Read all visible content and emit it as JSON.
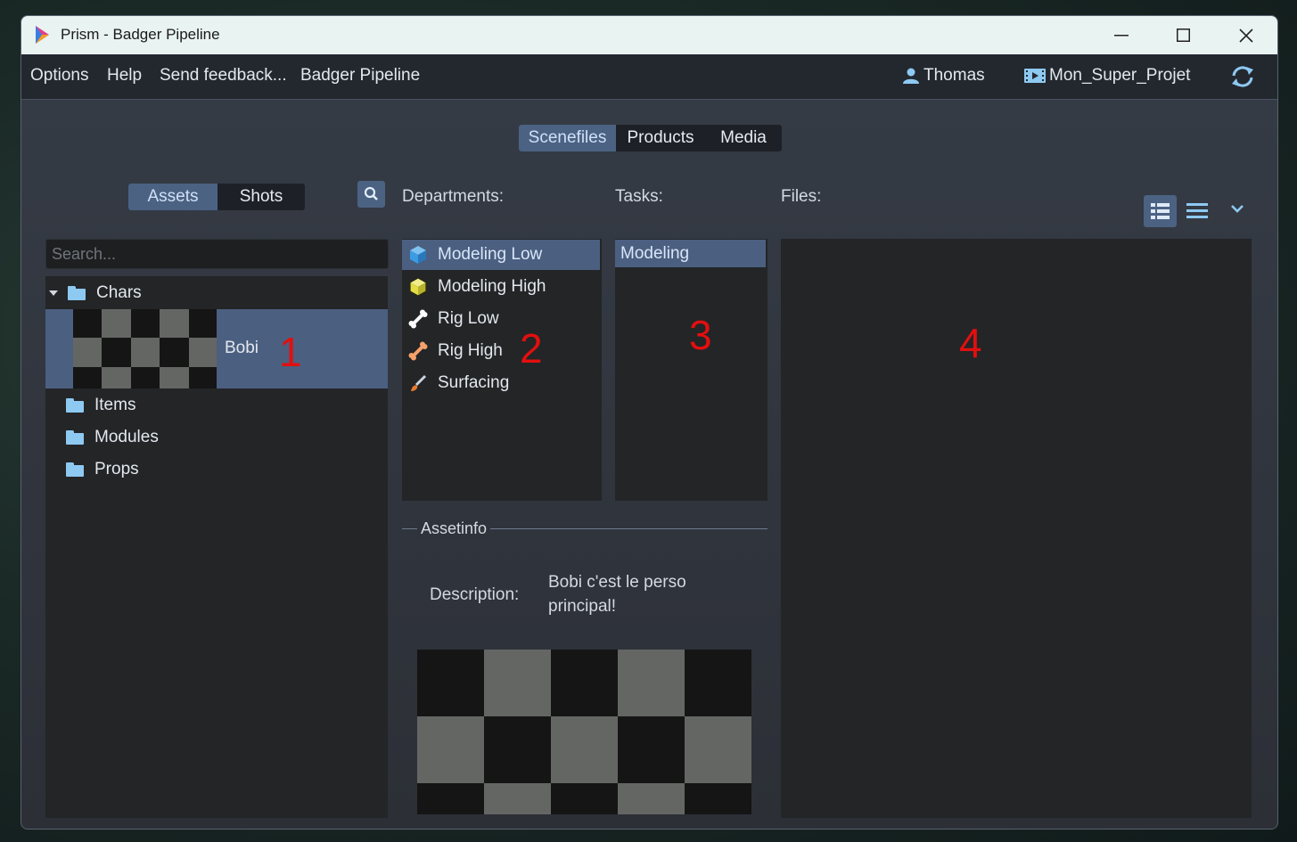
{
  "window": {
    "title": "Prism - Badger Pipeline"
  },
  "menubar": {
    "items": [
      "Options",
      "Help",
      "Send feedback...",
      "Badger Pipeline"
    ],
    "user": "Thomas",
    "project": "Mon_Super_Projet"
  },
  "top_tabs": {
    "items": [
      "Scenefiles",
      "Products",
      "Media"
    ],
    "active": "Scenefiles"
  },
  "entity_tabs": {
    "items": [
      "Assets",
      "Shots"
    ],
    "active": "Assets"
  },
  "search": {
    "placeholder": "Search..."
  },
  "tree": {
    "group": "Chars",
    "selected_asset": "Bobi",
    "folders": [
      "Items",
      "Modules",
      "Props"
    ]
  },
  "departments": {
    "label": "Departments:",
    "items": [
      {
        "name": "Modeling Low",
        "icon": "cube-icon",
        "color": "#3b9be4",
        "selected": true
      },
      {
        "name": "Modeling High",
        "icon": "cube-icon",
        "color": "#e2dd45",
        "selected": false
      },
      {
        "name": "Rig Low",
        "icon": "bone-icon",
        "color": "#ffffff",
        "selected": false
      },
      {
        "name": "Rig High",
        "icon": "bone-icon",
        "color": "#f5a06a",
        "selected": false
      },
      {
        "name": "Surfacing",
        "icon": "brush-icon",
        "color": "#e87a2d",
        "selected": false
      }
    ]
  },
  "tasks": {
    "label": "Tasks:",
    "items": [
      "Modeling"
    ]
  },
  "files": {
    "label": "Files:"
  },
  "assetinfo": {
    "title": "Assetinfo",
    "description_label": "Description:",
    "description_line1": "Bobi c'est le perso",
    "description_line2": "principal!"
  },
  "annotations": [
    "1",
    "2",
    "3",
    "4"
  ],
  "colors": {
    "accent": "#4b6283",
    "selected_row": "#4b5f80",
    "annotation": "#e20f0f"
  }
}
